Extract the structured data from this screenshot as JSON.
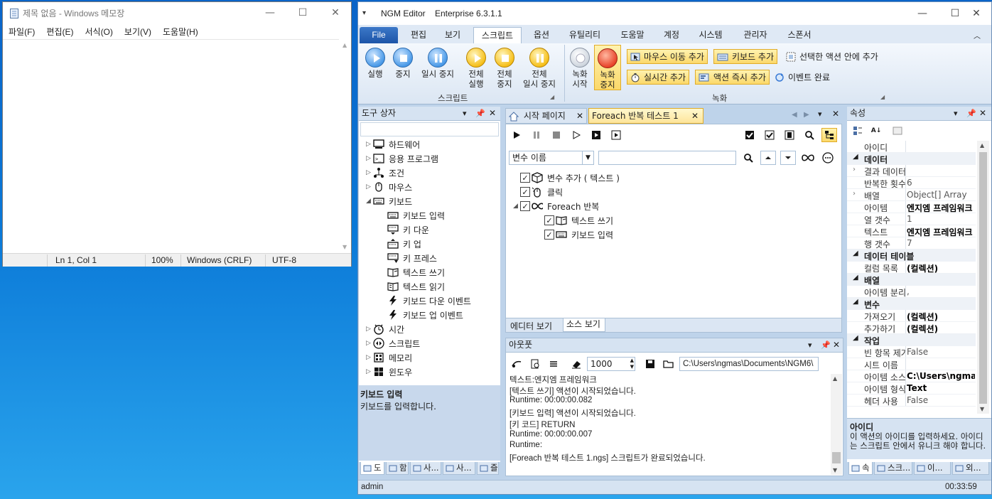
{
  "notepad": {
    "title": "제목 없음 - Windows 메모장",
    "menu": [
      "파일(F)",
      "편집(E)",
      "서식(O)",
      "보기(V)",
      "도움말(H)"
    ],
    "status": {
      "position": "Ln 1, Col 1",
      "zoom": "100%",
      "eol": "Windows (CRLF)",
      "encoding": "UTF-8"
    }
  },
  "ngm": {
    "app_name": "NGM Editor",
    "edition": "Enterprise 6.3.1.1",
    "ribbon_tabs": [
      "File",
      "편집",
      "보기",
      "스크립트",
      "옵션",
      "유틸리티",
      "도움말",
      "계정",
      "시스템",
      "관리자",
      "스폰서"
    ],
    "script_group": {
      "label": "스크립트",
      "run": "실행",
      "stop": "중지",
      "pause": "일시 중지",
      "run_all_1": "전체",
      "run_all_2": "실행",
      "stop_all_1": "전체",
      "stop_all_2": "중지",
      "pause_all_1": "전체",
      "pause_all_2": "일시 중지"
    },
    "record_group": {
      "label": "녹화",
      "rec_start_1": "녹화",
      "rec_start_2": "시작",
      "rec_stop_1": "녹화",
      "rec_stop_2": "중지",
      "add_mouse": "마우스 이동 추가",
      "add_keyboard": "키보드 추가",
      "add_in_selected": "선택한 액션 안에 추가",
      "add_realtime": "실시간 추가",
      "add_action_now": "액션 즉시 추가",
      "event_done": "이벤트 완료"
    },
    "toolbox": {
      "title": "도구 상자",
      "items": [
        {
          "label": "하드웨어",
          "icon": "computer-icon"
        },
        {
          "label": "응용 프로그램",
          "icon": "app-icon"
        },
        {
          "label": "조건",
          "icon": "condition-icon"
        },
        {
          "label": "마우스",
          "icon": "mouse-icon"
        },
        {
          "label": "키보드",
          "icon": "keyboard-icon"
        },
        {
          "label": "키보드 입력",
          "icon": "keyboard-icon"
        },
        {
          "label": "키 다운",
          "icon": "key-down-icon"
        },
        {
          "label": "키 업",
          "icon": "key-up-icon"
        },
        {
          "label": "키 프레스",
          "icon": "key-press-icon"
        },
        {
          "label": "텍스트 쓰기",
          "icon": "book-write-icon"
        },
        {
          "label": "텍스트 읽기",
          "icon": "book-read-icon"
        },
        {
          "label": "키보드 다운 이벤트",
          "icon": "lightning-icon"
        },
        {
          "label": "키보드 업 이벤트",
          "icon": "lightning-icon"
        },
        {
          "label": "시간",
          "icon": "clock-icon"
        },
        {
          "label": "스크립트",
          "icon": "script-icon"
        },
        {
          "label": "메모리",
          "icon": "memory-icon"
        },
        {
          "label": "윈도우",
          "icon": "windows-icon"
        }
      ],
      "desc_title": "키보드 입력",
      "desc_text": "키보드를 입력합니다.",
      "bottom_tabs": [
        "도",
        "함",
        "사...",
        "사...",
        "즐"
      ]
    },
    "doc_tabs": [
      "시작 페이지",
      "Foreach 반복 테스트 1"
    ],
    "editor": {
      "var_select": "변수 이름",
      "actions": [
        {
          "label": "변수 추가 ( 텍스트 )",
          "icon": "variable-icon"
        },
        {
          "label": "클릭",
          "icon": "click-icon"
        },
        {
          "label": "Foreach 반복",
          "icon": "loop-icon"
        },
        {
          "label": "텍스트 쓰기",
          "icon": "book-write-icon"
        },
        {
          "label": "키보드 입력",
          "icon": "keyboard-icon"
        }
      ],
      "view_tabs": [
        "에디터 보기",
        "소스 보기"
      ]
    },
    "output": {
      "title": "아웃풋",
      "count": "1000",
      "path": "C:\\Users\\ngmas\\Documents\\NGM6\\",
      "lines": [
        "텍스트:엔지엠 프레임워크",
        "[텍스트 쓰기] 액션이 시작되었습니다.",
        "Runtime: 00:00:00.082",
        "[키보드 입력] 액션이 시작되었습니다.",
        "[키 코드] RETURN",
        "Runtime: 00:00:00.007",
        "Runtime:",
        "[Foreach 반복 테스트 1.ngs] 스크립트가 완료되었습니다."
      ]
    },
    "properties": {
      "title": "속성",
      "rows": [
        {
          "t": "row",
          "k": "아이디",
          "v": ""
        },
        {
          "t": "cat",
          "k": "데이터"
        },
        {
          "t": "row",
          "k": "결과 데이터",
          "v": "",
          "exp": true
        },
        {
          "t": "row",
          "k": "반복한 횟수",
          "v": "6"
        },
        {
          "t": "row",
          "k": "배열",
          "v": "Object[] Array",
          "exp": true
        },
        {
          "t": "row",
          "k": "아이템",
          "v": "엔지엠 프레임워크",
          "b": true
        },
        {
          "t": "row",
          "k": "열 갯수",
          "v": "1"
        },
        {
          "t": "row",
          "k": "텍스트",
          "v": "엔지엠 프레임워크",
          "b": true
        },
        {
          "t": "row",
          "k": "행 갯수",
          "v": "7"
        },
        {
          "t": "cat",
          "k": "데이터 테이블"
        },
        {
          "t": "row",
          "k": "컬럼 목록",
          "v": "(컬렉션)",
          "b": true
        },
        {
          "t": "cat",
          "k": "배열"
        },
        {
          "t": "row",
          "k": "아이템 분리",
          "v": ","
        },
        {
          "t": "cat",
          "k": "변수"
        },
        {
          "t": "row",
          "k": "가져오기",
          "v": "(컬렉션)",
          "b": true
        },
        {
          "t": "row",
          "k": "추가하기",
          "v": "(컬렉션)",
          "b": true
        },
        {
          "t": "cat",
          "k": "작업"
        },
        {
          "t": "row",
          "k": "빈 항목 제거",
          "v": "False"
        },
        {
          "t": "row",
          "k": "시트 이름",
          "v": ""
        },
        {
          "t": "row",
          "k": "아이템 소스",
          "v": "C:\\Users\\ngmas",
          "b": true
        },
        {
          "t": "row",
          "k": "아이템 형식",
          "v": "Text",
          "b": true
        },
        {
          "t": "row",
          "k": "헤더 사용",
          "v": "False"
        }
      ],
      "desc_title": "아이디",
      "desc_text": "이 액션의 아이디를 입력하세요. 아이디는 스크립트 안에서 유니크 해야 합니다.",
      "bottom_tabs": [
        "속",
        "스크...",
        "이...",
        "외..."
      ]
    },
    "status": {
      "user": "admin",
      "time": "00:33:59"
    }
  },
  "colors": {
    "ribbon_file": "#1d55a8",
    "desktop": "#0a78d7",
    "highlight": "#fbd86a",
    "panel_head": "#d6e3f2"
  }
}
